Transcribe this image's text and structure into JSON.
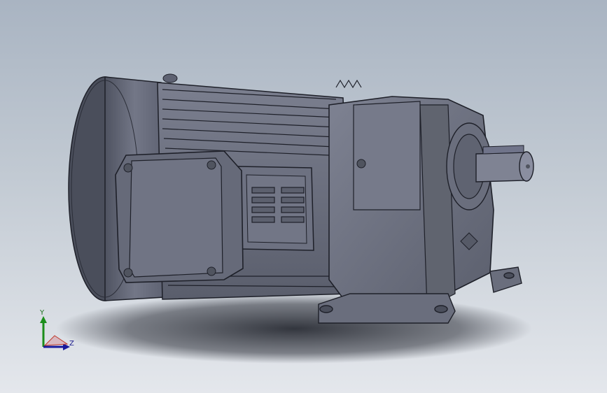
{
  "viewport": {
    "background_top": "#a9b4c2",
    "background_bottom": "#e4e7ec",
    "model_color": "#6b6f7e"
  },
  "model": {
    "name_hidden": "",
    "icon": "geared-motor-3d-model"
  },
  "triad": {
    "y_label": "Y",
    "z_label": "Z",
    "y_color": "#1b8e1b",
    "z_color": "#1a1a9c",
    "x_color": "#c0392b"
  }
}
